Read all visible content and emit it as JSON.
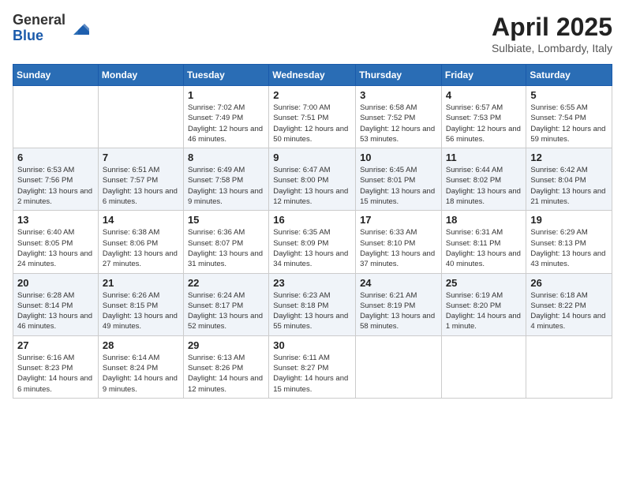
{
  "logo": {
    "general": "General",
    "blue": "Blue"
  },
  "title": "April 2025",
  "location": "Sulbiate, Lombardy, Italy",
  "days_of_week": [
    "Sunday",
    "Monday",
    "Tuesday",
    "Wednesday",
    "Thursday",
    "Friday",
    "Saturday"
  ],
  "weeks": [
    [
      {
        "num": "",
        "info": ""
      },
      {
        "num": "",
        "info": ""
      },
      {
        "num": "1",
        "info": "Sunrise: 7:02 AM\nSunset: 7:49 PM\nDaylight: 12 hours and 46 minutes."
      },
      {
        "num": "2",
        "info": "Sunrise: 7:00 AM\nSunset: 7:51 PM\nDaylight: 12 hours and 50 minutes."
      },
      {
        "num": "3",
        "info": "Sunrise: 6:58 AM\nSunset: 7:52 PM\nDaylight: 12 hours and 53 minutes."
      },
      {
        "num": "4",
        "info": "Sunrise: 6:57 AM\nSunset: 7:53 PM\nDaylight: 12 hours and 56 minutes."
      },
      {
        "num": "5",
        "info": "Sunrise: 6:55 AM\nSunset: 7:54 PM\nDaylight: 12 hours and 59 minutes."
      }
    ],
    [
      {
        "num": "6",
        "info": "Sunrise: 6:53 AM\nSunset: 7:56 PM\nDaylight: 13 hours and 2 minutes."
      },
      {
        "num": "7",
        "info": "Sunrise: 6:51 AM\nSunset: 7:57 PM\nDaylight: 13 hours and 6 minutes."
      },
      {
        "num": "8",
        "info": "Sunrise: 6:49 AM\nSunset: 7:58 PM\nDaylight: 13 hours and 9 minutes."
      },
      {
        "num": "9",
        "info": "Sunrise: 6:47 AM\nSunset: 8:00 PM\nDaylight: 13 hours and 12 minutes."
      },
      {
        "num": "10",
        "info": "Sunrise: 6:45 AM\nSunset: 8:01 PM\nDaylight: 13 hours and 15 minutes."
      },
      {
        "num": "11",
        "info": "Sunrise: 6:44 AM\nSunset: 8:02 PM\nDaylight: 13 hours and 18 minutes."
      },
      {
        "num": "12",
        "info": "Sunrise: 6:42 AM\nSunset: 8:04 PM\nDaylight: 13 hours and 21 minutes."
      }
    ],
    [
      {
        "num": "13",
        "info": "Sunrise: 6:40 AM\nSunset: 8:05 PM\nDaylight: 13 hours and 24 minutes."
      },
      {
        "num": "14",
        "info": "Sunrise: 6:38 AM\nSunset: 8:06 PM\nDaylight: 13 hours and 27 minutes."
      },
      {
        "num": "15",
        "info": "Sunrise: 6:36 AM\nSunset: 8:07 PM\nDaylight: 13 hours and 31 minutes."
      },
      {
        "num": "16",
        "info": "Sunrise: 6:35 AM\nSunset: 8:09 PM\nDaylight: 13 hours and 34 minutes."
      },
      {
        "num": "17",
        "info": "Sunrise: 6:33 AM\nSunset: 8:10 PM\nDaylight: 13 hours and 37 minutes."
      },
      {
        "num": "18",
        "info": "Sunrise: 6:31 AM\nSunset: 8:11 PM\nDaylight: 13 hours and 40 minutes."
      },
      {
        "num": "19",
        "info": "Sunrise: 6:29 AM\nSunset: 8:13 PM\nDaylight: 13 hours and 43 minutes."
      }
    ],
    [
      {
        "num": "20",
        "info": "Sunrise: 6:28 AM\nSunset: 8:14 PM\nDaylight: 13 hours and 46 minutes."
      },
      {
        "num": "21",
        "info": "Sunrise: 6:26 AM\nSunset: 8:15 PM\nDaylight: 13 hours and 49 minutes."
      },
      {
        "num": "22",
        "info": "Sunrise: 6:24 AM\nSunset: 8:17 PM\nDaylight: 13 hours and 52 minutes."
      },
      {
        "num": "23",
        "info": "Sunrise: 6:23 AM\nSunset: 8:18 PM\nDaylight: 13 hours and 55 minutes."
      },
      {
        "num": "24",
        "info": "Sunrise: 6:21 AM\nSunset: 8:19 PM\nDaylight: 13 hours and 58 minutes."
      },
      {
        "num": "25",
        "info": "Sunrise: 6:19 AM\nSunset: 8:20 PM\nDaylight: 14 hours and 1 minute."
      },
      {
        "num": "26",
        "info": "Sunrise: 6:18 AM\nSunset: 8:22 PM\nDaylight: 14 hours and 4 minutes."
      }
    ],
    [
      {
        "num": "27",
        "info": "Sunrise: 6:16 AM\nSunset: 8:23 PM\nDaylight: 14 hours and 6 minutes."
      },
      {
        "num": "28",
        "info": "Sunrise: 6:14 AM\nSunset: 8:24 PM\nDaylight: 14 hours and 9 minutes."
      },
      {
        "num": "29",
        "info": "Sunrise: 6:13 AM\nSunset: 8:26 PM\nDaylight: 14 hours and 12 minutes."
      },
      {
        "num": "30",
        "info": "Sunrise: 6:11 AM\nSunset: 8:27 PM\nDaylight: 14 hours and 15 minutes."
      },
      {
        "num": "",
        "info": ""
      },
      {
        "num": "",
        "info": ""
      },
      {
        "num": "",
        "info": ""
      }
    ]
  ]
}
